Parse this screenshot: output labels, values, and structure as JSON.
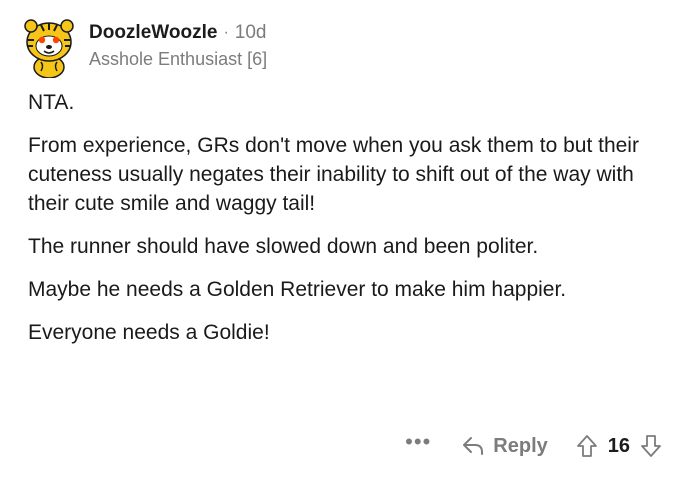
{
  "comment": {
    "username": "DoozleWoozle",
    "separator": "·",
    "age": "10d",
    "flair": "Asshole Enthusiast [6]",
    "paragraphs": [
      "NTA.",
      "From experience, GRs don't move when you ask them to but their cuteness usually negates their inability to shift out of the way with their cute smile and waggy tail!",
      "The runner should have slowed down and been politer.",
      "Maybe he needs a Golden Retriever to make him happier.",
      "Everyone needs a Goldie!"
    ],
    "actions": {
      "more": "•••",
      "reply_label": "Reply",
      "score": "16"
    }
  },
  "colors": {
    "avatar_yellow": "#f5c518",
    "avatar_orange": "#e08a1e",
    "meta_gray": "#7c7c7c",
    "text": "#1a1a1b"
  },
  "icons": {
    "avatar": "snoo-tiger-avatar",
    "reply": "reply-arrow-icon",
    "upvote": "upvote-arrow-icon",
    "downvote": "downvote-arrow-icon"
  }
}
